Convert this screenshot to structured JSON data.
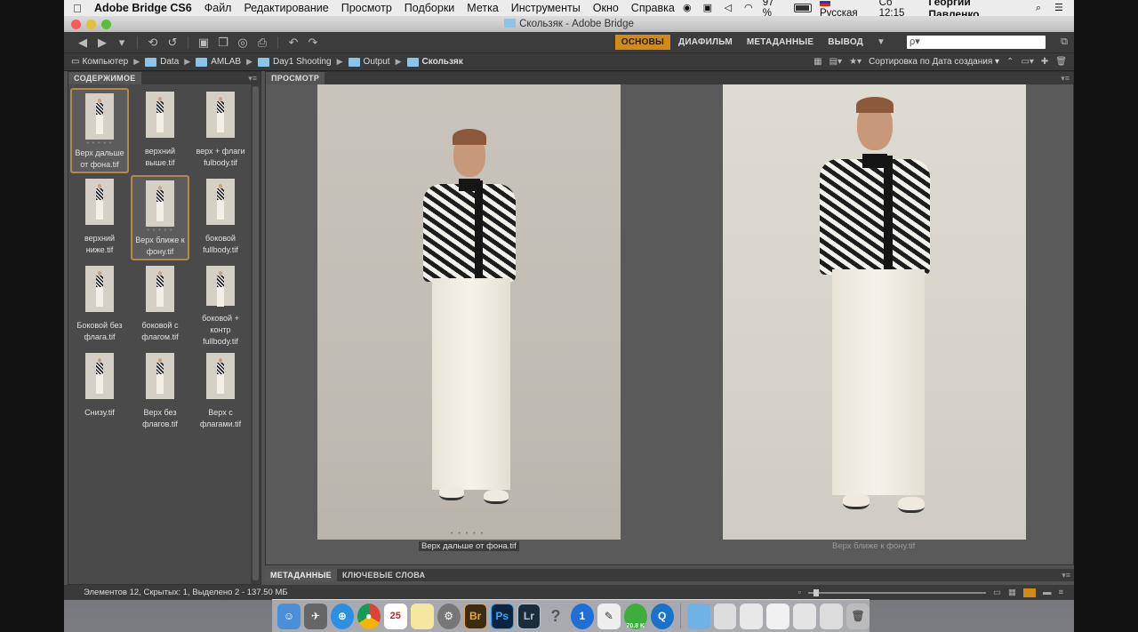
{
  "menubar": {
    "app_name": "Adobe Bridge CS6",
    "items": [
      "Файл",
      "Редактирование",
      "Просмотр",
      "Подборки",
      "Метка",
      "Инструменты",
      "Окно",
      "Справка"
    ],
    "battery": "97 %",
    "language": "Русская",
    "clock": "Сб 12:15",
    "user": "Георгий Павленко"
  },
  "window": {
    "title": "Скользяк - Adobe Bridge"
  },
  "workspaces": {
    "items": [
      "ОСНОВЫ",
      "ДИАФИЛЬМ",
      "МЕТАДАННЫЕ",
      "ВЫВОД"
    ],
    "active": "ОСНОВЫ",
    "search_placeholder": "ρ▾"
  },
  "pathbar": {
    "crumbs": [
      "Компьютер",
      "Data",
      "AMLAB",
      "Day1 Shooting",
      "Output",
      "Скользяк"
    ],
    "sort_label": "Сортировка по Дата создания ▾"
  },
  "content_panel": {
    "tab_label": "СОДЕРЖИМОЕ",
    "items": [
      {
        "label": "Верх дальше от фона.tif",
        "selected": true
      },
      {
        "label": "верхний выше.tif",
        "selected": false
      },
      {
        "label": "верх + флаги fulbody.tif",
        "selected": false
      },
      {
        "label": "верхний ниже.tif",
        "selected": false
      },
      {
        "label": "Верх ближе к фону.tif",
        "selected": true
      },
      {
        "label": "боковой fullbody.tif",
        "selected": false
      },
      {
        "label": "Боковой без флага.tif",
        "selected": false
      },
      {
        "label": "боковой с флагом.tif",
        "selected": false
      },
      {
        "label": "боковой + контр fullbody.tif",
        "selected": false
      },
      {
        "label": "Снизу.tif",
        "selected": false
      },
      {
        "label": "Верх без флагов.tif",
        "selected": false
      },
      {
        "label": "Верх с флагами.tif",
        "selected": false
      }
    ]
  },
  "preview_panel": {
    "tab_label": "ПРОСМОТР",
    "captions": [
      "Верх дальше от фона.tif",
      "Верх ближе к фону.tif"
    ]
  },
  "bottom_tabs": [
    "МЕТАДАННЫЕ",
    "КЛЮЧЕВЫЕ СЛОВА"
  ],
  "status": {
    "text": "Элементов 12, Скрытых: 1, Выделено 2 - 137.50 МБ"
  },
  "dock": {
    "calendar_day": "25",
    "utorrent_badge": "70.8 K"
  },
  "colors": {
    "accent": "#d08a18",
    "selection_border": "#b08a4a"
  }
}
